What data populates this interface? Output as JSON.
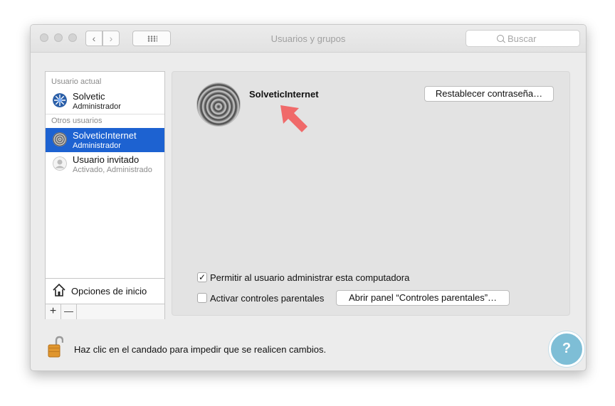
{
  "window": {
    "title": "Usuarios y grupos",
    "search_placeholder": "Buscar",
    "nav": {
      "back_glyph": "‹",
      "forward_glyph": "›"
    }
  },
  "sidebar": {
    "section_current": "Usuario actual",
    "current_user": {
      "name": "Solvetic",
      "role": "Administrador",
      "icon": "blue-star-avatar-icon"
    },
    "section_others": "Otros usuarios",
    "other_users": [
      {
        "name": "SolveticInternet",
        "role": "Administrador",
        "selected": true,
        "icon": "spiral-avatar-icon"
      },
      {
        "name": "Usuario invitado",
        "role": "Activado, Administrado",
        "selected": false,
        "icon": "person-avatar-icon"
      }
    ],
    "login_options": "Opciones de inicio",
    "add_glyph": "+",
    "remove_glyph": "—"
  },
  "main": {
    "user_name": "SolveticInternet",
    "reset_password_button": "Restablecer contraseña…",
    "allow_admin_label": "Permitir al usuario administrar esta computadora",
    "allow_admin_checked": true,
    "parental_controls_label": "Activar controles parentales",
    "parental_controls_checked": false,
    "open_parental_panel_button": "Abrir panel “Controles parentales”…"
  },
  "footer": {
    "lock_message": "Haz clic en el candado para impedir que se realicen cambios."
  },
  "watermark": {
    "glyph": "?"
  },
  "colors": {
    "selection": "#1d62d1",
    "annotation_arrow": "#f06a6a",
    "lock": "#e0962e"
  }
}
